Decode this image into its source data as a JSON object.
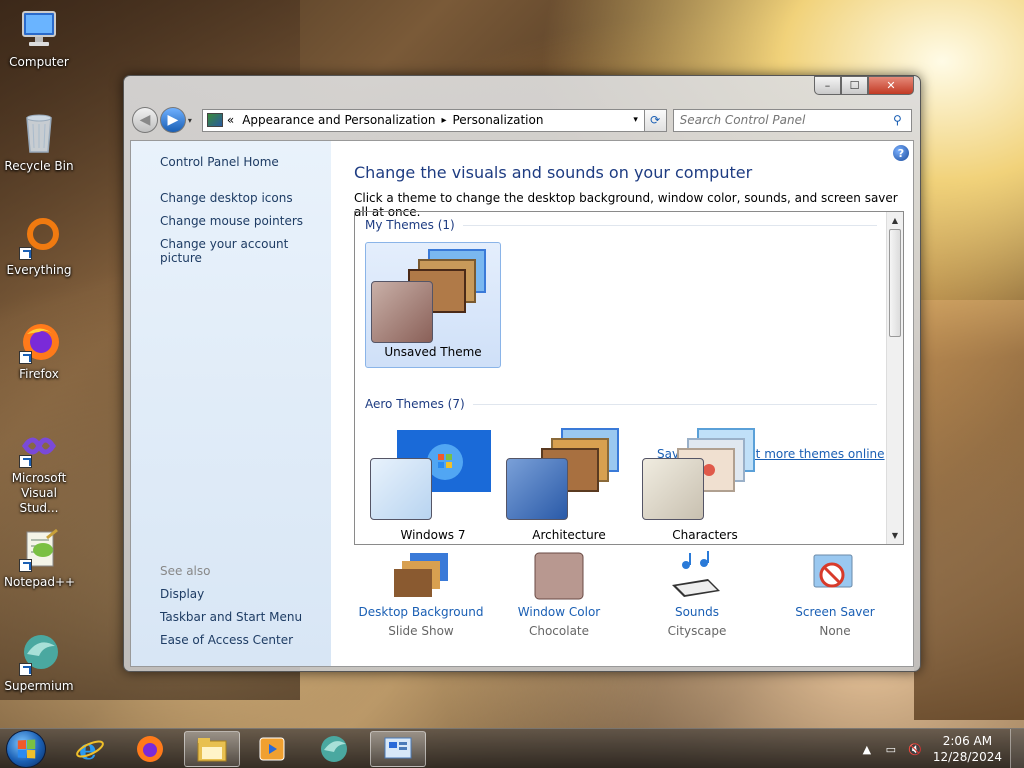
{
  "desktop": {
    "icons": [
      {
        "label": "Computer",
        "icon": "computer-icon"
      },
      {
        "label": "Recycle Bin",
        "icon": "recycle-bin-icon"
      },
      {
        "label": "Everything",
        "icon": "everything-icon"
      },
      {
        "label": "Firefox",
        "icon": "firefox-icon"
      },
      {
        "label": "Microsoft Visual Stud...",
        "icon": "visual-studio-icon"
      },
      {
        "label": "Notepad++",
        "icon": "notepad-plus-plus-icon"
      },
      {
        "label": "Supermium",
        "icon": "supermium-icon"
      }
    ]
  },
  "window": {
    "controls": {
      "minimize": "–",
      "maximize": "☐",
      "close": "✕"
    },
    "address": {
      "prefix": "«",
      "crumbs": [
        "Appearance and Personalization",
        "Personalization"
      ],
      "separator": "▸"
    },
    "search_placeholder": "Search Control Panel",
    "left_pane": {
      "home": "Control Panel Home",
      "links": [
        "Change desktop icons",
        "Change mouse pointers",
        "Change your account picture"
      ],
      "see_also_label": "See also",
      "see_also": [
        "Display",
        "Taskbar and Start Menu",
        "Ease of Access Center"
      ]
    },
    "main": {
      "title": "Change the visuals and sounds on your computer",
      "subtitle": "Click a theme to change the desktop background, window color, sounds, and screen saver all at once.",
      "my_themes_header": "My Themes (1)",
      "my_themes": [
        {
          "name": "Unsaved Theme",
          "selected": true
        }
      ],
      "save_theme": "Save theme",
      "get_more": "Get more themes online",
      "aero_header": "Aero Themes (7)",
      "aero_themes": [
        {
          "name": "Windows 7"
        },
        {
          "name": "Architecture"
        },
        {
          "name": "Characters"
        }
      ]
    },
    "bottom": [
      {
        "link": "Desktop Background",
        "value": "Slide Show",
        "icon": "desktop-background-icon"
      },
      {
        "link": "Window Color",
        "value": "Chocolate",
        "icon": "window-color-icon"
      },
      {
        "link": "Sounds",
        "value": "Cityscape",
        "icon": "sounds-icon"
      },
      {
        "link": "Screen Saver",
        "value": "None",
        "icon": "screen-saver-icon"
      }
    ]
  },
  "taskbar": {
    "pinned": [
      "internet-explorer-icon",
      "firefox-icon",
      "file-explorer-icon",
      "media-player-icon",
      "supermium-icon",
      "control-panel-icon"
    ],
    "active": "control-panel-icon",
    "clock": {
      "time": "2:06 AM",
      "date": "12/28/2024"
    },
    "tray": [
      "show-hidden-icons",
      "network-icon",
      "volume-muted-icon"
    ]
  },
  "colors": {
    "link": "#1a5fb4",
    "heading": "#1e3c82",
    "accent_close": "#c23a24"
  }
}
